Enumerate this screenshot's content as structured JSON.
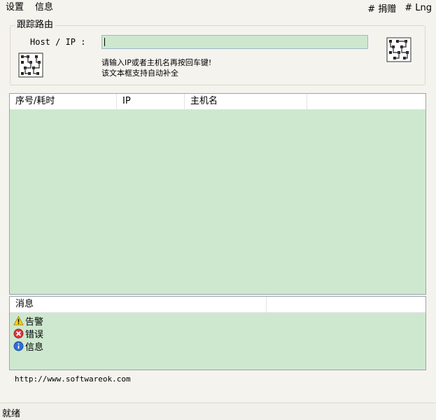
{
  "menu": {
    "settings": "设置",
    "info": "信息",
    "donate": "# 捐赠",
    "language": "# Lng"
  },
  "trace_group": {
    "title": "跟踪路由",
    "host_label": "Host / IP :",
    "host_value": "",
    "hint_line1": "请输入IP或者主机名再按回车键!",
    "hint_line2": "该文本框支持自动补全"
  },
  "results_table": {
    "columns": [
      "序号/耗时",
      "IP",
      "主机名",
      ""
    ],
    "rows": []
  },
  "messages": {
    "columns": [
      "消息",
      ""
    ],
    "items": [
      {
        "icon": "warning-icon",
        "label": "告警"
      },
      {
        "icon": "error-icon",
        "label": "错误"
      },
      {
        "icon": "info-icon",
        "label": "信息"
      }
    ]
  },
  "footer": {
    "url": "http://www.softwareok.com"
  },
  "status": {
    "text": "就绪"
  },
  "colors": {
    "list_background": "#cde8cf",
    "window_background": "#f4f3ee"
  }
}
